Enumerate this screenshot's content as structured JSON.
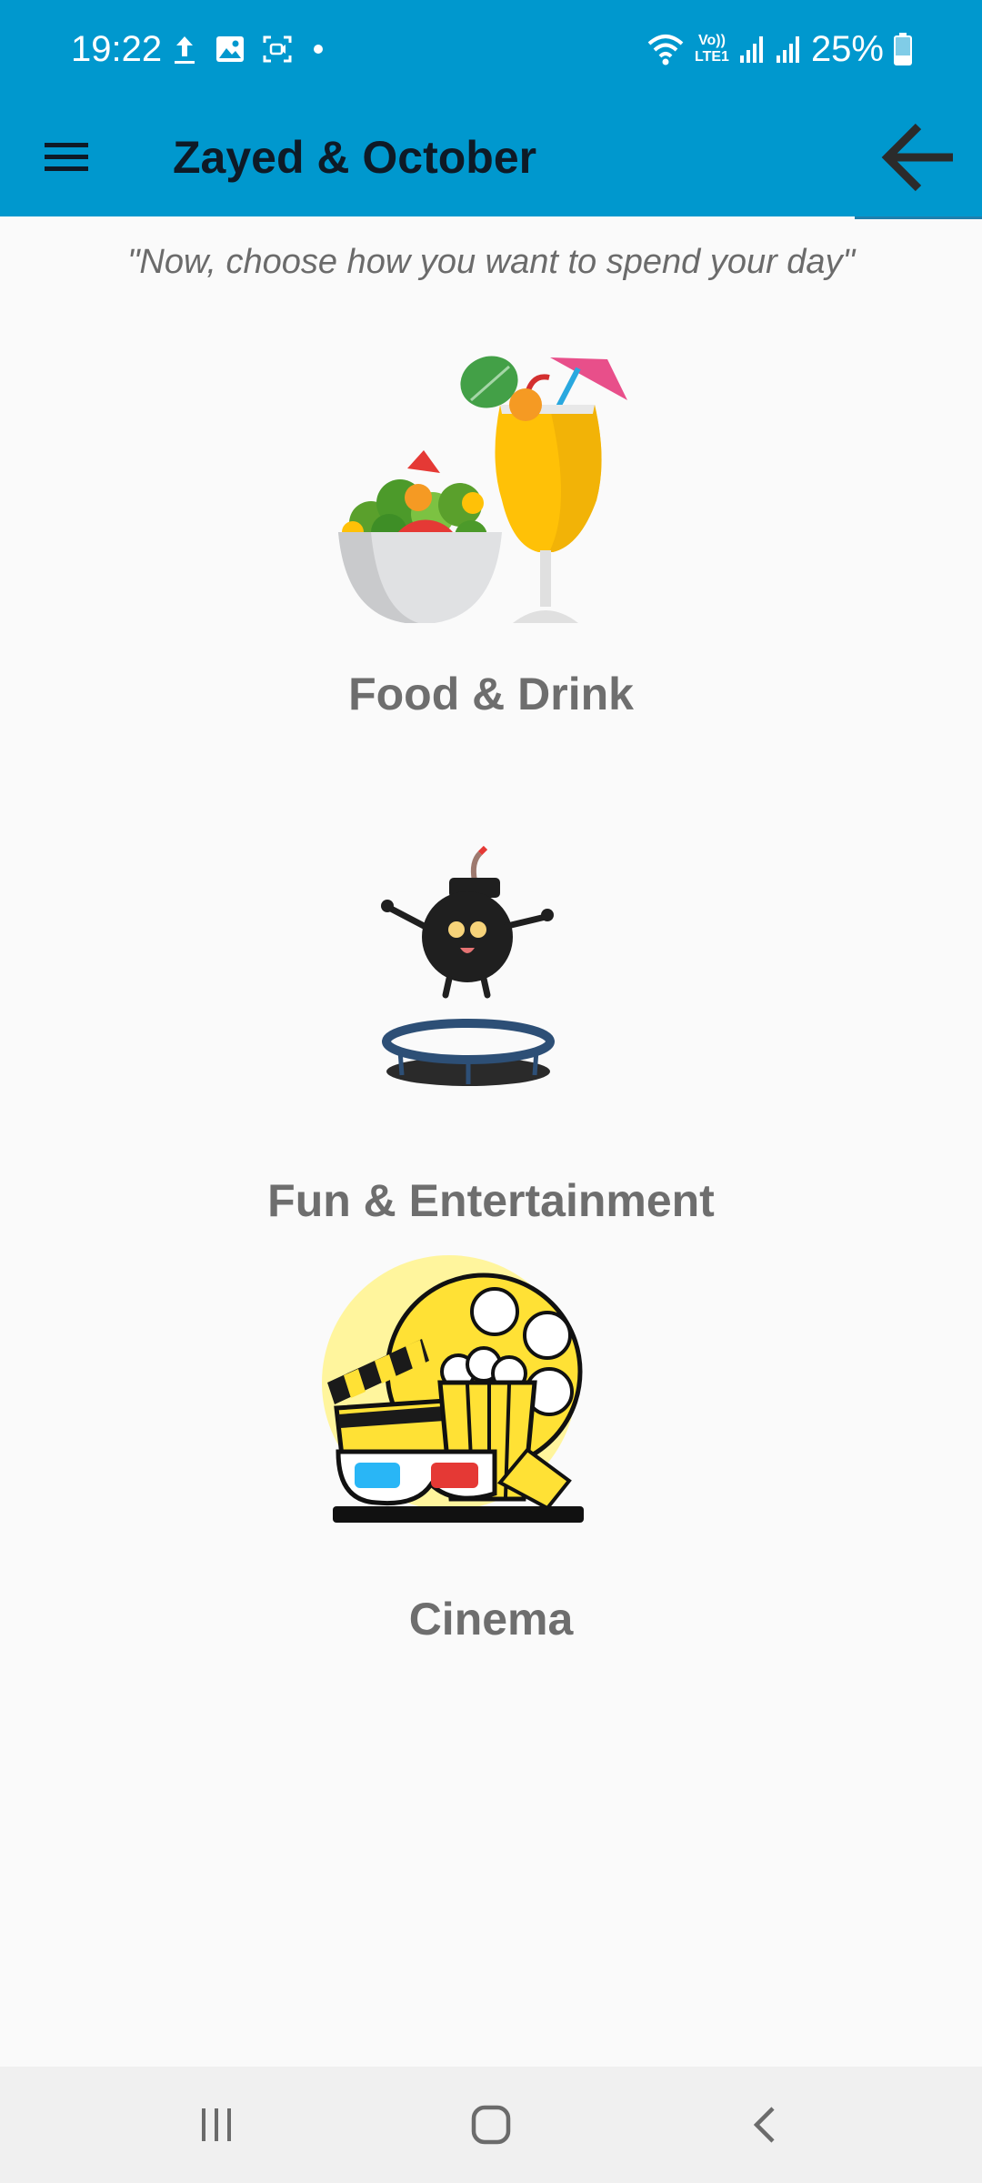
{
  "status_bar": {
    "time": "19:22",
    "battery": "25%",
    "icons_left": [
      "upload-icon",
      "gallery-icon",
      "screenshot-icon",
      "dot-icon"
    ],
    "icons_right": [
      "wifi-icon",
      "volte-icon",
      "signal-icon",
      "signal-icon",
      "battery-icon"
    ],
    "volte_label": "Vo))",
    "lte_label": "LTE1"
  },
  "app_bar": {
    "title": "Zayed & October",
    "menu_icon": "hamburger-menu-icon",
    "back_icon": "arrow-back-icon",
    "background": "#0098ce"
  },
  "main": {
    "prompt": "\"Now, choose how  you want to spend your day\"",
    "options": [
      {
        "label": "Food & Drink",
        "icon": "food-drink-icon"
      },
      {
        "label": "Fun & Entertainment",
        "icon": "fun-entertainment-icon"
      },
      {
        "label": "Cinema",
        "icon": "cinema-icon"
      }
    ]
  },
  "nav_bar": {
    "buttons": [
      "recent-apps-icon",
      "home-icon",
      "back-icon"
    ]
  }
}
